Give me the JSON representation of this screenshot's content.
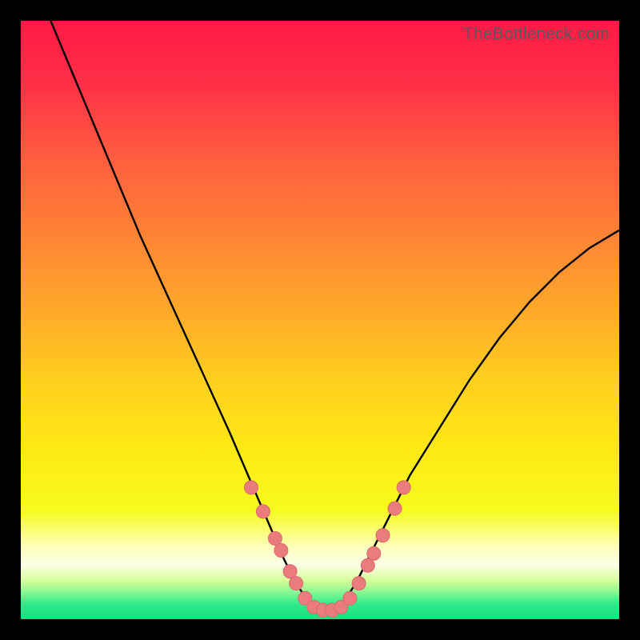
{
  "watermark": "TheBottleneck.com",
  "colors": {
    "frame": "#000000",
    "curve": "#000000",
    "dot_fill": "#eb7c7e",
    "dot_stroke": "#d86a6c",
    "gradient_stops": [
      {
        "offset": "0%",
        "color": "#ff1a46"
      },
      {
        "offset": "10%",
        "color": "#ff2e47"
      },
      {
        "offset": "22%",
        "color": "#ff5a40"
      },
      {
        "offset": "35%",
        "color": "#ff8136"
      },
      {
        "offset": "48%",
        "color": "#ffa72a"
      },
      {
        "offset": "60%",
        "color": "#ffcf1e"
      },
      {
        "offset": "72%",
        "color": "#feea14"
      },
      {
        "offset": "82%",
        "color": "#f6fb20"
      },
      {
        "offset": "88%",
        "color": "#ffffbe"
      },
      {
        "offset": "91%",
        "color": "#fbffe6"
      },
      {
        "offset": "93.5%",
        "color": "#d7ff9a"
      },
      {
        "offset": "95.5%",
        "color": "#88f894"
      },
      {
        "offset": "97.5%",
        "color": "#2fe989"
      },
      {
        "offset": "100%",
        "color": "#17e080"
      }
    ]
  },
  "chart_data": {
    "type": "line",
    "title": "",
    "xlabel": "",
    "ylabel": "",
    "xlim": [
      0,
      100
    ],
    "ylim": [
      0,
      100
    ],
    "series": [
      {
        "name": "bottleneck-curve",
        "x": [
          5,
          10,
          15,
          20,
          25,
          30,
          35,
          38,
          41,
          44,
          46,
          48,
          50,
          52,
          54,
          56,
          58,
          61,
          65,
          70,
          75,
          80,
          85,
          90,
          95,
          100
        ],
        "y": [
          100,
          88,
          76,
          64,
          53,
          42,
          31,
          24,
          17,
          10,
          6,
          3,
          1.5,
          1.5,
          3,
          6,
          10,
          16,
          24,
          32,
          40,
          47,
          53,
          58,
          62,
          65
        ]
      }
    ],
    "markers": {
      "name": "highlighted-points",
      "x": [
        38.5,
        40.5,
        42.5,
        43.5,
        45.0,
        46.0,
        47.5,
        49.0,
        50.5,
        52.0,
        53.5,
        55.0,
        56.5,
        58.0,
        59.0,
        60.5,
        62.5,
        64.0
      ],
      "y": [
        22.0,
        18.0,
        13.5,
        11.5,
        8.0,
        6.0,
        3.5,
        2.0,
        1.5,
        1.5,
        2.0,
        3.5,
        6.0,
        9.0,
        11.0,
        14.0,
        18.5,
        22.0
      ]
    }
  }
}
